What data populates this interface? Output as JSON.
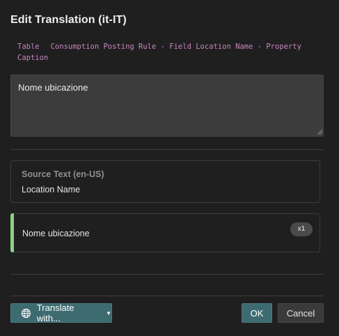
{
  "dialog": {
    "title": "Edit Translation (it-IT)"
  },
  "context": {
    "type": "Table",
    "path_line1": "Consumption Posting Rule - Field Location Name - Property",
    "path_line2": "Caption"
  },
  "editor": {
    "value": "Nome ubicazione"
  },
  "source": {
    "heading": "Source Text (en-US)",
    "text": "Location Name"
  },
  "suggestion": {
    "text": "Nome ubicazione",
    "count": "x1",
    "accent_color": "#89d185"
  },
  "footer": {
    "translate_label": "Translate with...",
    "translate_icon": "globe-icon",
    "ok_label": "OK",
    "cancel_label": "Cancel"
  },
  "colors": {
    "background": "#1f1f1f",
    "primary_button": "#3d6b70",
    "context_text": "#c586c0"
  }
}
